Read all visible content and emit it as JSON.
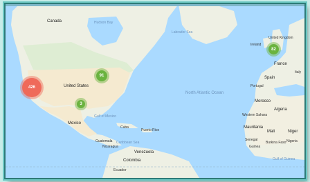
{
  "labels": {
    "canada": "Canada",
    "hudson_bay": "Hudson Bay",
    "labrador_sea": "Labrador Sea",
    "united_states": "United States",
    "mexico": "Mexico",
    "gulf_of_mexico": "Gulf of Mexico",
    "cuba": "Cuba",
    "puerto_rico": "Puerto Rico",
    "guatemala": "Guatemala",
    "nicaragua": "Nicaragua",
    "caribbean_sea": "Caribbean Sea",
    "venezuela": "Venezuela",
    "colombia": "Colombia",
    "ecuador": "Ecuador",
    "north_atlantic_ocean": "North Atlantic Ocean",
    "ireland": "Ireland",
    "united_kingdom": "United Kingdom",
    "france": "France",
    "italy": "Italy",
    "spain": "Spain",
    "portugal": "Portugal",
    "morocco": "Morocco",
    "algeria": "Algeria",
    "western_sahara": "Western Sahara",
    "mauritania": "Mauritania",
    "mali": "Mali",
    "niger": "Niger",
    "nigeria": "Nigeria",
    "burkina_faso": "Burkina Faso",
    "gulf_of_guinea": "Gulf of Guinea",
    "guinea": "Guinea",
    "senegal": "Senegal"
  },
  "clusters": [
    {
      "label": "426",
      "color": "#ef6a5a"
    },
    {
      "label": "91",
      "color": "#6ab33f"
    },
    {
      "label": "3",
      "color": "#6ab33f"
    },
    {
      "label": "82",
      "color": "#6ab33f"
    }
  ],
  "colors": {
    "water": "#aadaff",
    "land": "#eef0e4",
    "us_land": "#f5ead0",
    "forest": "#d4ebc8",
    "frame": "#2e7b78"
  }
}
